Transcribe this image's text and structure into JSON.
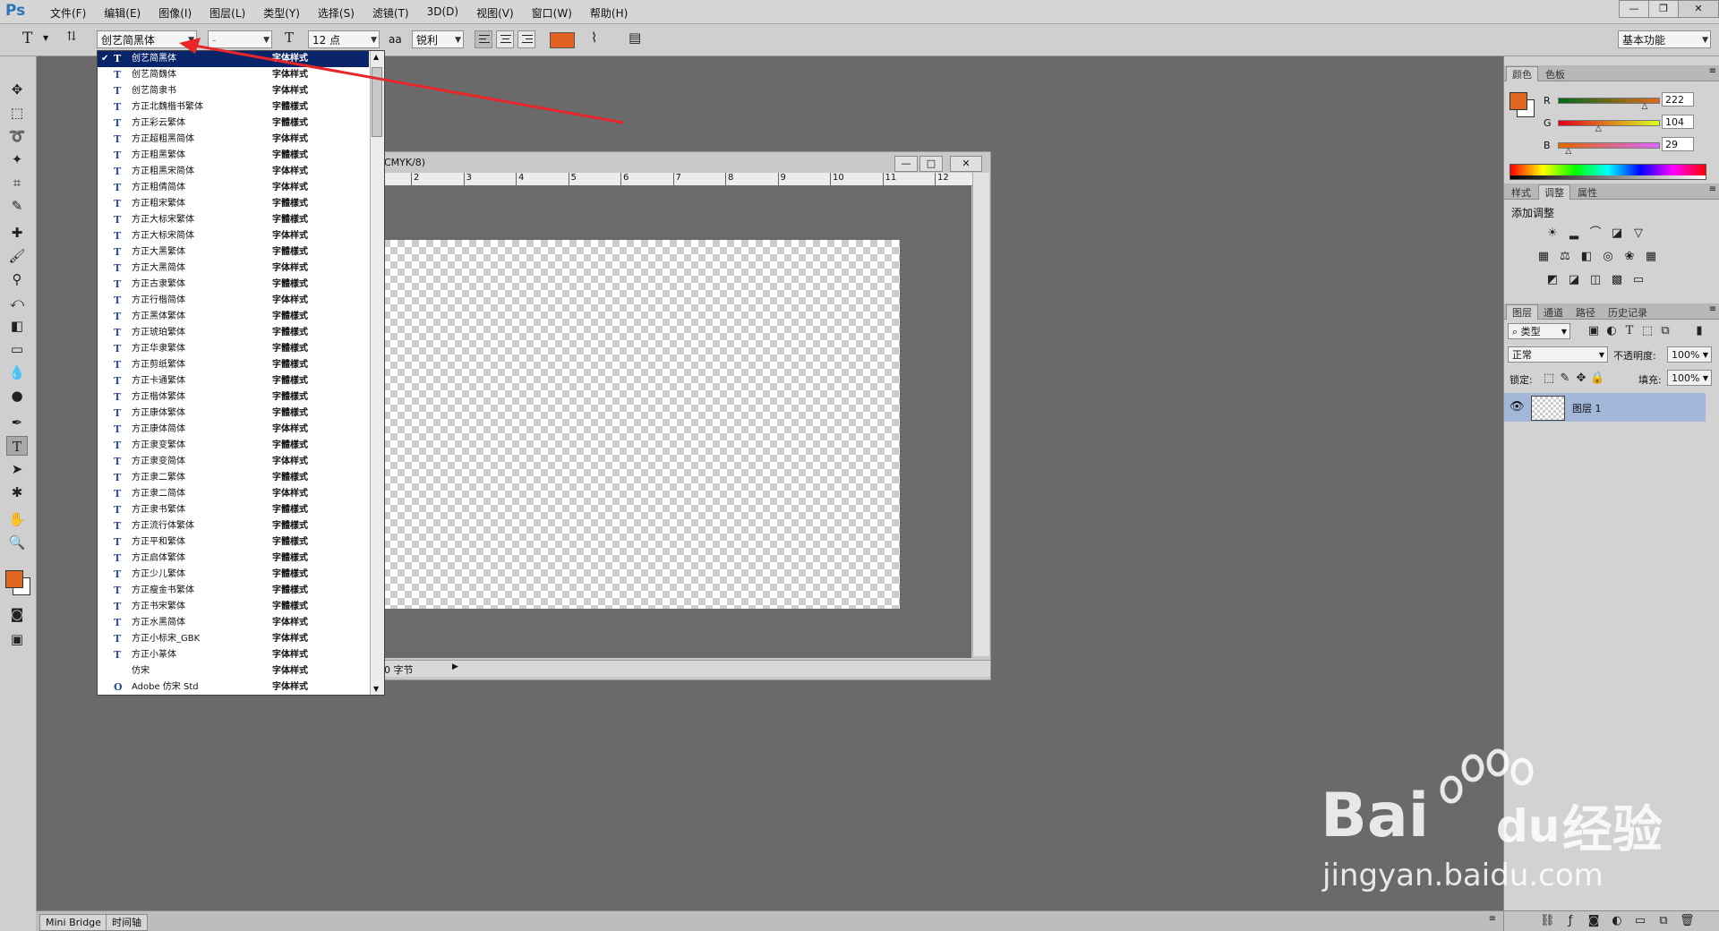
{
  "app": {
    "logo": "Ps"
  },
  "menu": [
    "文件(F)",
    "编辑(E)",
    "图像(I)",
    "图层(L)",
    "类型(Y)",
    "选择(S)",
    "滤镜(T)",
    "3D(D)",
    "视图(V)",
    "窗口(W)",
    "帮助(H)"
  ],
  "window_controls": {
    "minimize": "—",
    "restore": "❐",
    "close": "✕"
  },
  "options": {
    "tool_glyph": "T",
    "font_family": "创艺简黑体",
    "font_style": "-",
    "font_size": "12 点",
    "aa_label": "aa",
    "antialias": "锐利",
    "text_color": "#e1601f",
    "workspace": "基本功能"
  },
  "font_list": {
    "items": [
      {
        "name": "创艺简黑体",
        "sample": "字体样式",
        "selected": true,
        "icon": "T"
      },
      {
        "name": "创艺简魏体",
        "sample": "字体样式",
        "icon": "T"
      },
      {
        "name": "创艺简隶书",
        "sample": "字体样式",
        "icon": "T"
      },
      {
        "name": "方正北魏楷书繁体",
        "sample": "字體樣式",
        "icon": "T"
      },
      {
        "name": "方正彩云繁体",
        "sample": "字體樣式",
        "icon": "T"
      },
      {
        "name": "方正超粗黑简体",
        "sample": "字体样式",
        "icon": "T"
      },
      {
        "name": "方正粗黑繁体",
        "sample": "字體樣式",
        "icon": "T"
      },
      {
        "name": "方正粗黑宋简体",
        "sample": "字体样式",
        "icon": "T"
      },
      {
        "name": "方正粗倩简体",
        "sample": "字体样式",
        "icon": "T"
      },
      {
        "name": "方正粗宋繁体",
        "sample": "字體樣式",
        "icon": "T"
      },
      {
        "name": "方正大标宋繁体",
        "sample": "字體樣式",
        "icon": "T"
      },
      {
        "name": "方正大标宋简体",
        "sample": "字体样式",
        "icon": "T"
      },
      {
        "name": "方正大黑繁体",
        "sample": "字體樣式",
        "icon": "T"
      },
      {
        "name": "方正大黑简体",
        "sample": "字体样式",
        "icon": "T"
      },
      {
        "name": "方正古隶繁体",
        "sample": "字體樣式",
        "icon": "T"
      },
      {
        "name": "方正行楷简体",
        "sample": "字体样式",
        "icon": "T"
      },
      {
        "name": "方正黑体繁体",
        "sample": "字體樣式",
        "icon": "T"
      },
      {
        "name": "方正琥珀繁体",
        "sample": "字體樣式",
        "icon": "T"
      },
      {
        "name": "方正华隶繁体",
        "sample": "字體樣式",
        "icon": "T"
      },
      {
        "name": "方正剪纸繁体",
        "sample": "字體樣式",
        "icon": "T"
      },
      {
        "name": "方正卡通繁体",
        "sample": "字體樣式",
        "icon": "T"
      },
      {
        "name": "方正楷体繁体",
        "sample": "字體樣式",
        "icon": "T"
      },
      {
        "name": "方正康体繁体",
        "sample": "字體樣式",
        "icon": "T"
      },
      {
        "name": "方正康体简体",
        "sample": "字体样式",
        "icon": "T"
      },
      {
        "name": "方正隶变繁体",
        "sample": "字體樣式",
        "icon": "T"
      },
      {
        "name": "方正隶变简体",
        "sample": "字体样式",
        "icon": "T"
      },
      {
        "name": "方正隶二繁体",
        "sample": "字體樣式",
        "icon": "T"
      },
      {
        "name": "方正隶二简体",
        "sample": "字体样式",
        "icon": "T"
      },
      {
        "name": "方正隶书繁体",
        "sample": "字體樣式",
        "icon": "T"
      },
      {
        "name": "方正流行体繁体",
        "sample": "字體樣式",
        "icon": "T"
      },
      {
        "name": "方正平和繁体",
        "sample": "字體樣式",
        "icon": "T"
      },
      {
        "name": "方正启体繁体",
        "sample": "字體樣式",
        "icon": "T"
      },
      {
        "name": "方正少儿繁体",
        "sample": "字體樣式",
        "icon": "T"
      },
      {
        "name": "方正瘦金书繁体",
        "sample": "字體樣式",
        "icon": "T"
      },
      {
        "name": "方正书宋繁体",
        "sample": "字體樣式",
        "icon": "T"
      },
      {
        "name": "方正水黑简体",
        "sample": "字体样式",
        "icon": "T"
      },
      {
        "name": "方正小标宋_GBK",
        "sample": "字体样式",
        "icon": "T"
      },
      {
        "name": "方正小篆体",
        "sample": "字体样式",
        "icon": "T"
      },
      {
        "name": "仿宋",
        "sample": "字体样式",
        "icon": ""
      },
      {
        "name": "Adobe 仿宋 Std",
        "sample": "字体样式",
        "icon": "O"
      }
    ]
  },
  "document": {
    "title_fragment": "CMYK/8)",
    "ruler_ticks": [
      "2",
      "3",
      "4",
      "5",
      "6",
      "7",
      "8",
      "9",
      "10",
      "11",
      "12"
    ],
    "status": "0 字节"
  },
  "color_panel": {
    "tabs": [
      "颜色",
      "色板"
    ],
    "fg_color": "#de6821",
    "channels": [
      {
        "label": "R",
        "value": "222",
        "level": 0.87
      },
      {
        "label": "G",
        "value": "104",
        "level": 0.41
      },
      {
        "label": "B",
        "value": "29",
        "level": 0.11
      }
    ]
  },
  "adjust_panel": {
    "tabs": [
      "样式",
      "调整",
      "属性"
    ],
    "title": "添加调整"
  },
  "layers_panel": {
    "tabs": [
      "图层",
      "通道",
      "路径",
      "历史记录"
    ],
    "filter_kind": "类型",
    "blend_mode": "正常",
    "opacity_label": "不透明度:",
    "opacity": "100%",
    "lock_label": "锁定:",
    "fill_label": "填充:",
    "fill": "100%",
    "layers": [
      {
        "name": "图层 1",
        "visible": true
      }
    ]
  },
  "bottom_tabs": [
    "Mini Bridge",
    "时间轴"
  ],
  "watermark": {
    "brand": "Bai",
    "brand2": "du",
    "cn": "经验",
    "url": "jingyan.baidu.com"
  }
}
